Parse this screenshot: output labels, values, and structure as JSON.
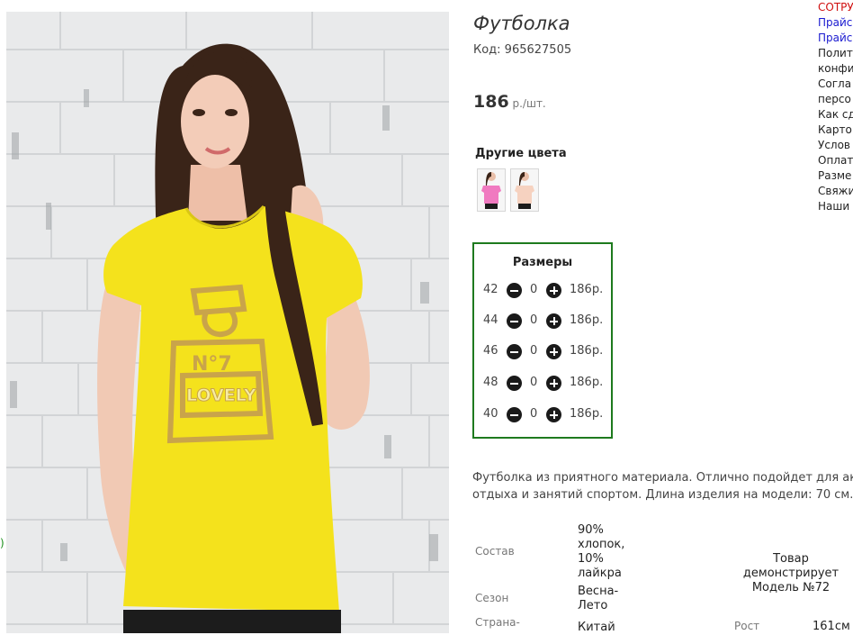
{
  "product": {
    "title": "Футболка",
    "code": "Код: 965627505",
    "price": "186",
    "price_unit": " р./шт."
  },
  "colors": {
    "label": "Другие цвета",
    "swatches": [
      {
        "name": "pink",
        "color": "#f07ac0"
      },
      {
        "name": "peach",
        "color": "#f6d2c0"
      }
    ]
  },
  "sizes": {
    "title": "Размеры",
    "rows": [
      {
        "size": "42",
        "qty": "0",
        "price": "186р."
      },
      {
        "size": "44",
        "qty": "0",
        "price": "186р."
      },
      {
        "size": "46",
        "qty": "0",
        "price": "186р."
      },
      {
        "size": "48",
        "qty": "0",
        "price": "186р."
      },
      {
        "size": "40",
        "qty": "0",
        "price": "186р."
      }
    ]
  },
  "description": {
    "line1": "Футболка из приятного материала. Отлично подойдет для актив",
    "line2": "отдыха и занятий спортом. Длина изделия на модели: 70 см."
  },
  "specs": {
    "composition_label": "Состав",
    "composition_lines": [
      "90%",
      "хлопок,",
      "10%",
      "лайкра"
    ],
    "season_label": "Сезон",
    "season_lines": [
      "Весна-",
      "Лето"
    ],
    "country_label": "Страна-",
    "country_value": "Китай",
    "model_note_lines": [
      "Товар",
      "демонстрирует",
      "Модель №72"
    ],
    "height_label": "Рост",
    "height_value": "161см"
  },
  "right_menu": [
    {
      "text": "СОТРУ",
      "style": "red"
    },
    {
      "text": "Прайс",
      "style": "blue"
    },
    {
      "text": "Прайс",
      "style": "blue"
    },
    {
      "text": "Полит",
      "style": "plain"
    },
    {
      "text": "конфи",
      "style": "plain"
    },
    {
      "text": "Согла",
      "style": "plain"
    },
    {
      "text": "персо",
      "style": "plain"
    },
    {
      "text": "Как сд",
      "style": "plain"
    },
    {
      "text": "Карто",
      "style": "plain"
    },
    {
      "text": "Услов",
      "style": "plain"
    },
    {
      "text": "Оплат",
      "style": "plain"
    },
    {
      "text": "Разме",
      "style": "plain"
    },
    {
      "text": "Свяжи",
      "style": "plain"
    },
    {
      "text": "Наши",
      "style": "plain"
    }
  ],
  "left_edge_mark": ")",
  "photo_print": {
    "number": "N°7",
    "word": "LOVELY"
  },
  "theme": {
    "accent_green": "#1e7a1e",
    "shirt_yellow": "#f4e21c",
    "gold": "#c9a44a"
  }
}
